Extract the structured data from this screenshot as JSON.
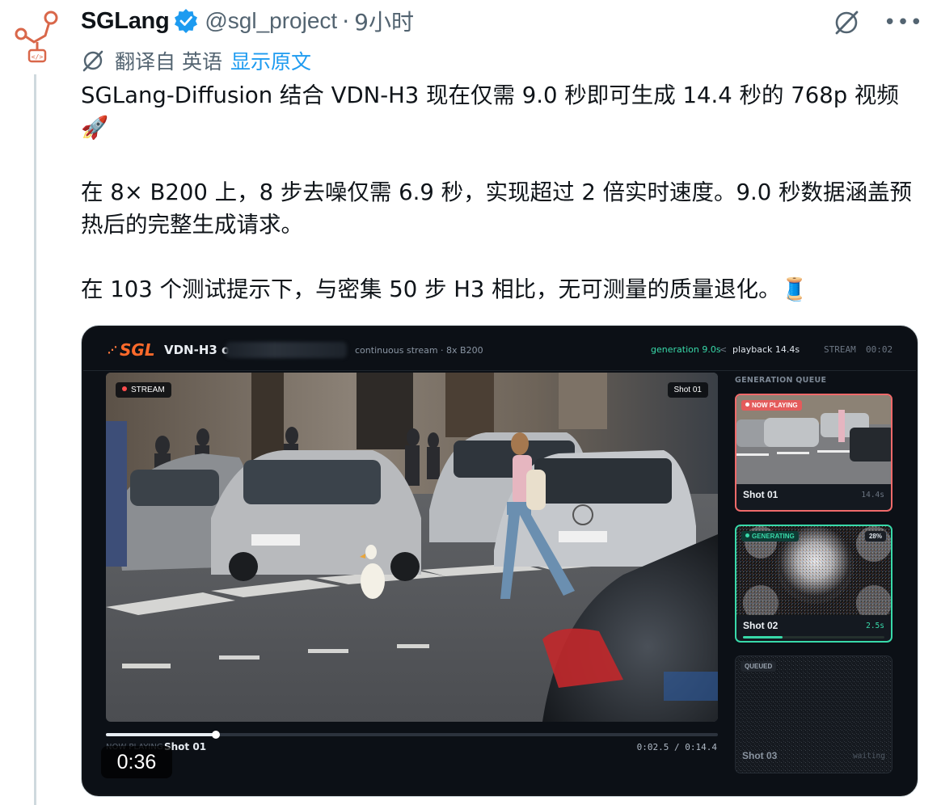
{
  "author": {
    "name": "SGLang",
    "handle": "@sgl_project",
    "separator": "·",
    "time": "9小时"
  },
  "icons": {
    "avatar": "sglang-logo-icon",
    "verified": "verified-badge-icon",
    "grok": "grok-icon",
    "more": "more-icon",
    "translate": "translate-icon"
  },
  "translation": {
    "label": "翻译自 英语",
    "link": "显示原文"
  },
  "tweet": {
    "p1": "SGLang-Diffusion 结合 VDN-H3 现在仅需 9.0 秒即可生成 14.4 秒的 768p 视频 🚀",
    "p2": "在 8× B200 上，8 步去噪仅需 6.9 秒，实现超过 2 倍实时速度。9.0 秒数据涵盖预热后的完整生成请求。",
    "p3": "在 103 个测试提示下，与密集 50 步 H3 相比，无可测量的质量退化。🧵"
  },
  "media": {
    "logo_text": "SGL",
    "title": "VDN-H3 o",
    "stream_info": "continuous stream · 8x B200",
    "generation": "generation 9.0s",
    "lt": "<",
    "playback": "playback 14.4s",
    "stream_label": "STREAM",
    "stream_time": "00:02",
    "stream_pill": "STREAM",
    "shot_pill": "Shot 01",
    "progress_fraction": 0.18,
    "now_playing_label": "NOW PLAYING",
    "now_playing_shot": "Shot 01",
    "timecode": "0:02.5 / 0:14.4",
    "duration_badge": "0:36",
    "queue_title": "GENERATION QUEUE",
    "queue": [
      {
        "badge": "NOW PLAYING",
        "label": "Shot 01",
        "value": "14.4s"
      },
      {
        "badge": "GENERATING",
        "percent": "28%",
        "label": "Shot 02",
        "value": "2.5s",
        "progress_fraction": 0.28
      },
      {
        "badge": "QUEUED",
        "label": "Shot 03",
        "value": "waiting"
      }
    ],
    "colors": {
      "accent_orange": "#ff6a2b",
      "accent_green": "#38d9a9",
      "now_playing_red": "#f06a6a",
      "link_blue": "#1d9bf0"
    }
  }
}
